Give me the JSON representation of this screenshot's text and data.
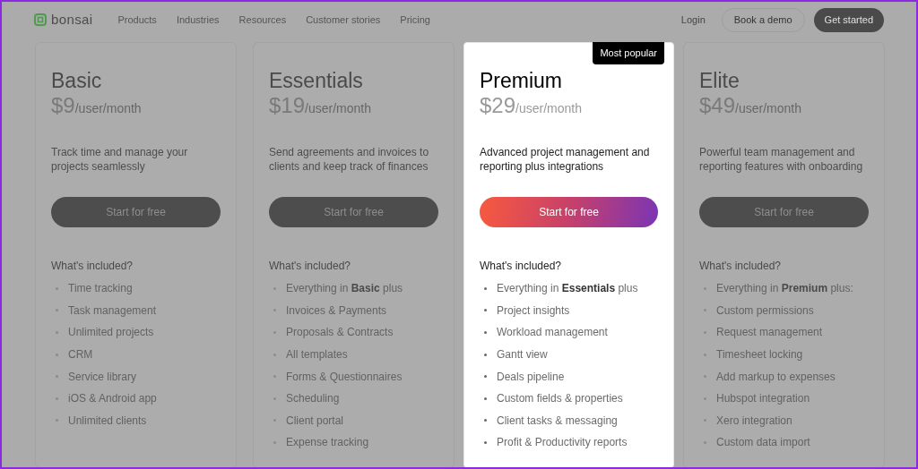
{
  "nav": {
    "brand": "bonsai",
    "links": [
      "Products",
      "Industries",
      "Resources",
      "Customer stories",
      "Pricing"
    ],
    "login": "Login",
    "demo": "Book a demo",
    "cta": "Get started"
  },
  "plans": [
    {
      "name": "Basic",
      "price": "$9",
      "unit": "/user/month",
      "description": "Track time and manage your projects seamlessly",
      "button": "Start for free",
      "highlighted": false,
      "included_title": "What's included?",
      "features": [
        "Time tracking",
        "Task management",
        "Unlimited projects",
        "CRM",
        "Service library",
        "iOS & Android app",
        "Unlimited clients"
      ]
    },
    {
      "name": "Essentials",
      "price": "$19",
      "unit": "/user/month",
      "description": "Send agreements and invoices to clients and keep track of finances",
      "button": "Start for free",
      "highlighted": false,
      "included_title": "What's included?",
      "features": [
        "Everything in **Basic** plus",
        "Invoices & Payments",
        "Proposals & Contracts",
        "All templates",
        "Forms & Questionnaires",
        "Scheduling",
        "Client portal",
        "Expense tracking"
      ]
    },
    {
      "name": "Premium",
      "price": "$29",
      "unit": "/user/month",
      "badge": "Most popular",
      "description": "Advanced project management and reporting plus integrations",
      "button": "Start for free",
      "highlighted": true,
      "included_title": "What's included?",
      "features": [
        "Everything in **Essentials** plus",
        "Project insights",
        "Workload management",
        "Gantt view",
        "Deals pipeline",
        "Custom fields & properties",
        "Client tasks & messaging",
        "Profit & Productivity reports"
      ]
    },
    {
      "name": "Elite",
      "price": "$49",
      "unit": "/user/month",
      "description": "Powerful team management and reporting features with onboarding",
      "button": "Start for free",
      "highlighted": false,
      "included_title": "What's included?",
      "features": [
        "Everything in **Premium** plus:",
        "Custom permissions",
        "Request management",
        "Timesheet locking",
        "Add markup to expenses",
        "Hubspot integration",
        "Xero integration",
        "Custom data import"
      ]
    }
  ]
}
